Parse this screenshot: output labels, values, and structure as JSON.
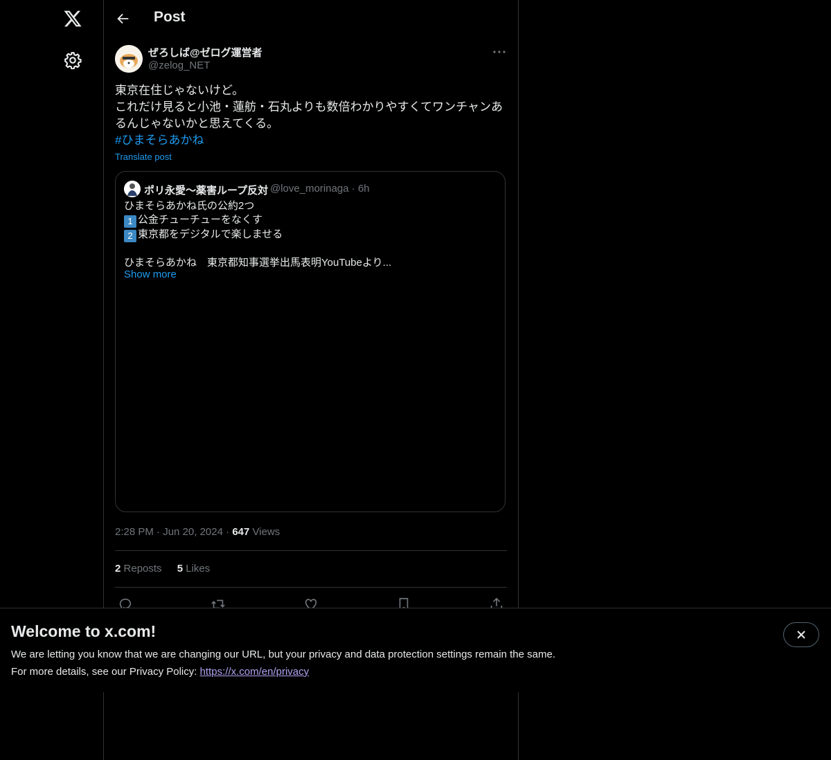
{
  "nav": {
    "logo_icon": "x-logo-icon",
    "settings_icon": "gear-icon"
  },
  "header": {
    "back_icon": "arrow-left-icon",
    "title": "Post"
  },
  "post": {
    "author_name": "ぜろしば@ゼログ運営者",
    "author_handle": "@zelog_NET",
    "text_lines": [
      "東京在住じゃないけど。",
      "これだけ見ると小池・蓮舫・石丸よりも数倍わかりやすくてワンチャンあ",
      "るんじゃないかと思えてくる。"
    ],
    "hashtag": "#ひまそらあかね",
    "translate": "Translate post",
    "time": "2:28 PM",
    "date": "Jun 20, 2024",
    "views_count": "647",
    "views_label": "Views",
    "reposts_count": "2",
    "reposts_label": "Reposts",
    "likes_count": "5",
    "likes_label": "Likes"
  },
  "quote": {
    "name": "ポリ永愛〜薬害ループ反対",
    "handle": "@love_morinaga",
    "time": "6h",
    "line1": "ひまそらあかね氏の公約2つ",
    "item1_num": "1",
    "item1": "公金チューチューをなくす",
    "item2_num": "2",
    "item2": "東京都をデジタルで楽しませる",
    "line4": "ひまそらあかね　東京都知事選挙出馬表明YouTubeより...",
    "show_more": "Show more"
  },
  "banner": {
    "title": "Welcome to x.com!",
    "line1": "We are letting you know that we are changing our URL, but your privacy and data protection settings remain the same.",
    "line2_prefix": "For more details, see our Privacy Policy: ",
    "link": "https://x.com/en/privacy"
  },
  "colors": {
    "accent": "#1d9bf0",
    "border": "#2f3336",
    "muted": "#71767b",
    "text": "#e7e9ea"
  }
}
